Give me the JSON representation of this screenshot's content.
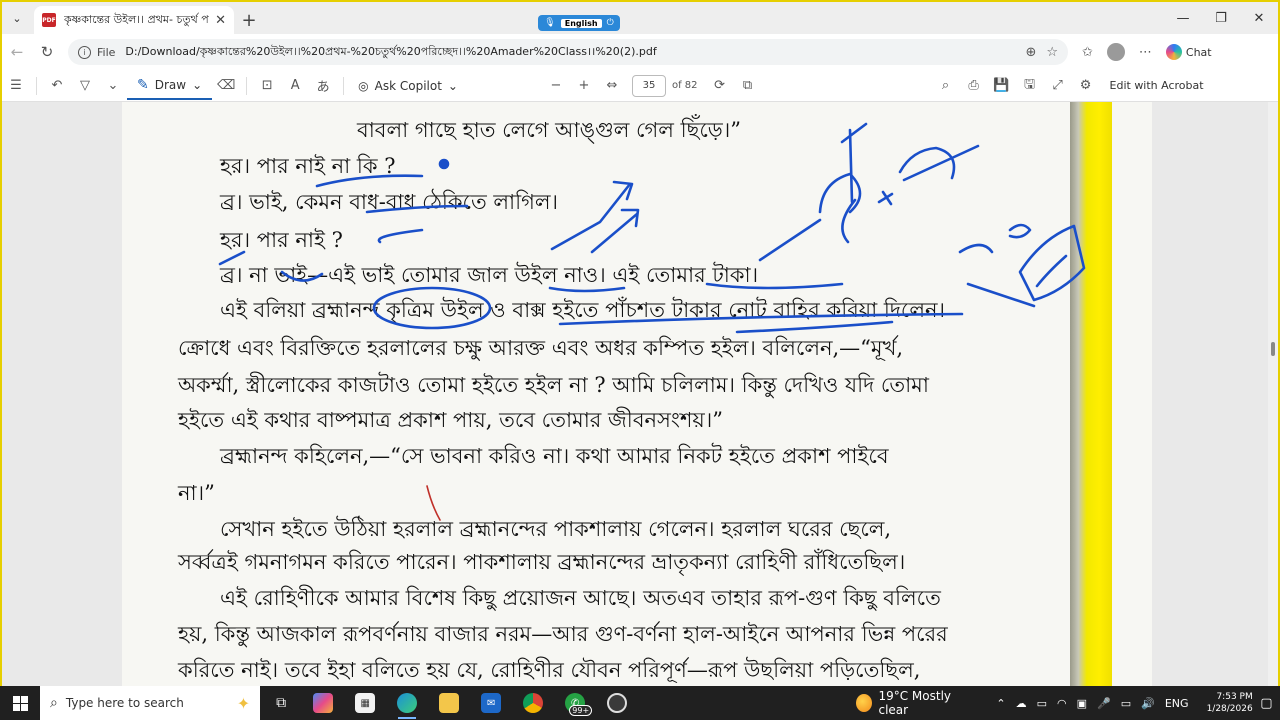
{
  "browser": {
    "tab_title": "কৃষ্ণকান্তের উইল।। প্রথম- চতুর্থ পরি",
    "tab_close": "✕",
    "new_tab": "+",
    "lang_label": "English",
    "url_scheme": "File",
    "url": "D:/Download/কৃষ্ণকান্তের%20উইল।।%20প্রথম-%20চতুর্থ%20পরিচ্ছেদ।।%20Amader%20Class।।%20(2).pdf",
    "copilot_label": "Chat"
  },
  "pdf_toolbar": {
    "draw_label": "Draw",
    "ask_copilot_label": "Ask Copilot",
    "page_current": "35",
    "page_total": "of 82",
    "edit_label": "Edit with Acrobat"
  },
  "page": {
    "lines": [
      "বাবলা গাছে হাত লেগে আঙ্গুল গেল ছিঁড়ে।”",
      "হর। পার নাই না কি ?",
      "ব্র। ভাই, কেমন বাধ-বাধ ঠেকিতে লাগিল।",
      "হর। পার নাই ?",
      "ব্র। না ভাই—এই ভাই তোমার জাল উইল নাও। এই তোমার টাকা।",
      "এই বলিয়া ব্রহ্মানন্দ কৃত্রিম উইল ও বাক্স হইতে পাঁচশত টাকার নোট বাহির করিয়া দিলেন।",
      "ক্রোধে এবং বিরক্তিতে হরলালের চক্ষু আরক্ত এবং অধর কম্পিত হইল। বলিলেন,—“মূর্খ,",
      "অকর্ম্মা, স্ত্রীলোকের কাজটাও তোমা হইতে হইল না ? আমি চলিলাম। কিন্তু দেখিও যদি তোমা",
      "হইতে এই কথার বাষ্পমাত্র প্রকাশ পায়, তবে তোমার জীবনসংশয়।”",
      "ব্রহ্মানন্দ কহিলেন,—“সে ভাবনা করিও না। কথা আমার নিকট হইতে প্রকাশ পাইবে",
      "না।”",
      "সেখান হইতে উঠিয়া হরলাল ব্রহ্মানন্দের পাকশালায় গেলেন। হরলাল ঘরের ছেলে,",
      "সর্ব্বত্রই গমনাগমন করিতে পারেন। পাকশালায় ব্রহ্মানন্দের ভ্রাতৃকন্যা রোহিণী রাঁধিতেছিল।",
      "এই রোহিণীকে আমার বিশেষ কিছু প্রয়োজন আছে। অতএব তাহার রূপ-গুণ কিছু বলিতে",
      "হয়, কিন্তু আজকাল রূপবর্ণনায় বাজার নরম—আর গুণ-বর্ণনা হাল-আইনে আপনার ভিন্ন পরের",
      "করিতে নাই। তবে ইহা বলিতে হয় যে, রোহিণীর যৌবন পরিপূর্ণ—রূপ উছলিয়া পড়িতেছিল,"
    ]
  },
  "taskbar": {
    "search_placeholder": "Type here to search",
    "chat_badge": "99+",
    "weather": "19°C  Mostly clear",
    "language": "ENG",
    "time": "7:53 PM",
    "date": "1/28/2026"
  },
  "colors": {
    "ink": "#1a4fc9",
    "frame": "#e6cf00",
    "spine_yellow": "#ffee00",
    "accent": "#1a5fb4"
  }
}
